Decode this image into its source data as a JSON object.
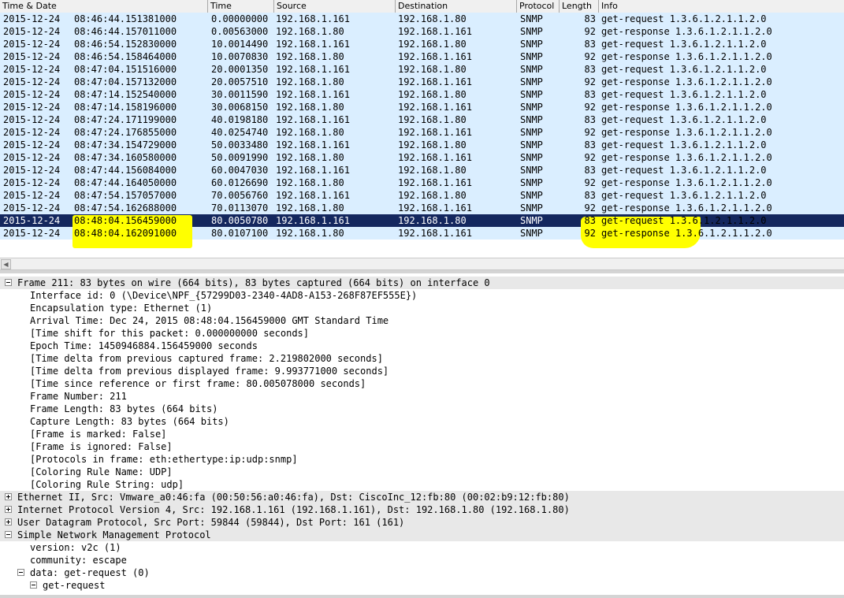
{
  "columns": {
    "time_date": "Time & Date",
    "time": "Time",
    "source": "Source",
    "destination": "Destination",
    "protocol": "Protocol",
    "length": "Length",
    "info": "Info"
  },
  "packets": [
    {
      "date": "2015-12-24",
      "clock": "08:46:44.151381000",
      "time": "0.00000000",
      "src": "192.168.1.161",
      "dst": "192.168.1.80",
      "proto": "SNMP",
      "len": "83",
      "info": "get-request 1.3.6.1.2.1.1.2.0"
    },
    {
      "date": "2015-12-24",
      "clock": "08:46:44.157011000",
      "time": "0.00563000",
      "src": "192.168.1.80",
      "dst": "192.168.1.161",
      "proto": "SNMP",
      "len": "92",
      "info": "get-response 1.3.6.1.2.1.1.2.0"
    },
    {
      "date": "2015-12-24",
      "clock": "08:46:54.152830000",
      "time": "10.0014490",
      "src": "192.168.1.161",
      "dst": "192.168.1.80",
      "proto": "SNMP",
      "len": "83",
      "info": "get-request 1.3.6.1.2.1.1.2.0"
    },
    {
      "date": "2015-12-24",
      "clock": "08:46:54.158464000",
      "time": "10.0070830",
      "src": "192.168.1.80",
      "dst": "192.168.1.161",
      "proto": "SNMP",
      "len": "92",
      "info": "get-response 1.3.6.1.2.1.1.2.0"
    },
    {
      "date": "2015-12-24",
      "clock": "08:47:04.151516000",
      "time": "20.0001350",
      "src": "192.168.1.161",
      "dst": "192.168.1.80",
      "proto": "SNMP",
      "len": "83",
      "info": "get-request 1.3.6.1.2.1.1.2.0"
    },
    {
      "date": "2015-12-24",
      "clock": "08:47:04.157132000",
      "time": "20.0057510",
      "src": "192.168.1.80",
      "dst": "192.168.1.161",
      "proto": "SNMP",
      "len": "92",
      "info": "get-response 1.3.6.1.2.1.1.2.0"
    },
    {
      "date": "2015-12-24",
      "clock": "08:47:14.152540000",
      "time": "30.0011590",
      "src": "192.168.1.161",
      "dst": "192.168.1.80",
      "proto": "SNMP",
      "len": "83",
      "info": "get-request 1.3.6.1.2.1.1.2.0"
    },
    {
      "date": "2015-12-24",
      "clock": "08:47:14.158196000",
      "time": "30.0068150",
      "src": "192.168.1.80",
      "dst": "192.168.1.161",
      "proto": "SNMP",
      "len": "92",
      "info": "get-response 1.3.6.1.2.1.1.2.0"
    },
    {
      "date": "2015-12-24",
      "clock": "08:47:24.171199000",
      "time": "40.0198180",
      "src": "192.168.1.161",
      "dst": "192.168.1.80",
      "proto": "SNMP",
      "len": "83",
      "info": "get-request 1.3.6.1.2.1.1.2.0"
    },
    {
      "date": "2015-12-24",
      "clock": "08:47:24.176855000",
      "time": "40.0254740",
      "src": "192.168.1.80",
      "dst": "192.168.1.161",
      "proto": "SNMP",
      "len": "92",
      "info": "get-response 1.3.6.1.2.1.1.2.0"
    },
    {
      "date": "2015-12-24",
      "clock": "08:47:34.154729000",
      "time": "50.0033480",
      "src": "192.168.1.161",
      "dst": "192.168.1.80",
      "proto": "SNMP",
      "len": "83",
      "info": "get-request 1.3.6.1.2.1.1.2.0"
    },
    {
      "date": "2015-12-24",
      "clock": "08:47:34.160580000",
      "time": "50.0091990",
      "src": "192.168.1.80",
      "dst": "192.168.1.161",
      "proto": "SNMP",
      "len": "92",
      "info": "get-response 1.3.6.1.2.1.1.2.0"
    },
    {
      "date": "2015-12-24",
      "clock": "08:47:44.156084000",
      "time": "60.0047030",
      "src": "192.168.1.161",
      "dst": "192.168.1.80",
      "proto": "SNMP",
      "len": "83",
      "info": "get-request 1.3.6.1.2.1.1.2.0"
    },
    {
      "date": "2015-12-24",
      "clock": "08:47:44.164050000",
      "time": "60.0126690",
      "src": "192.168.1.80",
      "dst": "192.168.1.161",
      "proto": "SNMP",
      "len": "92",
      "info": "get-response 1.3.6.1.2.1.1.2.0"
    },
    {
      "date": "2015-12-24",
      "clock": "08:47:54.157057000",
      "time": "70.0056760",
      "src": "192.168.1.161",
      "dst": "192.168.1.80",
      "proto": "SNMP",
      "len": "83",
      "info": "get-request 1.3.6.1.2.1.1.2.0"
    },
    {
      "date": "2015-12-24",
      "clock": "08:47:54.162688000",
      "time": "70.0113070",
      "src": "192.168.1.80",
      "dst": "192.168.1.161",
      "proto": "SNMP",
      "len": "92",
      "info": "get-response 1.3.6.1.2.1.1.2.0"
    },
    {
      "date": "2015-12-24",
      "clock": "08:48:04.156459000",
      "time": "80.0050780",
      "src": "192.168.1.161",
      "dst": "192.168.1.80",
      "proto": "SNMP",
      "len": "83",
      "info": "get-request 1.3.6.1.2.1.1.2.0"
    },
    {
      "date": "2015-12-24",
      "clock": "08:48:04.162091000",
      "time": "80.0107100",
      "src": "192.168.1.80",
      "dst": "192.168.1.161",
      "proto": "SNMP",
      "len": "92",
      "info": "get-response 1.3.6.1.2.1.1.2.0"
    }
  ],
  "details": [
    {
      "text": "Frame 211: 83 bytes on wire (664 bits), 83 bytes captured (664 bits) on interface 0",
      "toggle": "minus"
    },
    {
      "text": "Interface id: 0 (\\Device\\NPF_{57299D03-2340-4AD8-A153-268F87EF555E})",
      "toggle": ""
    },
    {
      "text": "Encapsulation type: Ethernet (1)",
      "toggle": ""
    },
    {
      "text": "Arrival Time: Dec 24, 2015 08:48:04.156459000 GMT Standard Time",
      "toggle": ""
    },
    {
      "text": "[Time shift for this packet: 0.000000000 seconds]",
      "toggle": ""
    },
    {
      "text": "Epoch Time: 1450946884.156459000 seconds",
      "toggle": ""
    },
    {
      "text": "[Time delta from previous captured frame: 2.219802000 seconds]",
      "toggle": ""
    },
    {
      "text": "[Time delta from previous displayed frame: 9.993771000 seconds]",
      "toggle": ""
    },
    {
      "text": "[Time since reference or first frame: 80.005078000 seconds]",
      "toggle": ""
    },
    {
      "text": "Frame Number: 211",
      "toggle": ""
    },
    {
      "text": "Frame Length: 83 bytes (664 bits)",
      "toggle": ""
    },
    {
      "text": "Capture Length: 83 bytes (664 bits)",
      "toggle": ""
    },
    {
      "text": "[Frame is marked: False]",
      "toggle": ""
    },
    {
      "text": "[Frame is ignored: False]",
      "toggle": ""
    },
    {
      "text": "[Protocols in frame: eth:ethertype:ip:udp:snmp]",
      "toggle": ""
    },
    {
      "text": "[Coloring Rule Name: UDP]",
      "toggle": ""
    },
    {
      "text": "[Coloring Rule String: udp]",
      "toggle": ""
    },
    {
      "text": "Ethernet II, Src: Vmware_a0:46:fa (00:50:56:a0:46:fa), Dst: CiscoInc_12:fb:80 (00:02:b9:12:fb:80)",
      "toggle": "plus"
    },
    {
      "text": "Internet Protocol Version 4, Src: 192.168.1.161 (192.168.1.161), Dst: 192.168.1.80 (192.168.1.80)",
      "toggle": "plus"
    },
    {
      "text": "User Datagram Protocol, Src Port: 59844 (59844), Dst Port: 161 (161)",
      "toggle": "plus"
    },
    {
      "text": "Simple Network Management Protocol",
      "toggle": "minus"
    },
    {
      "text": "version: v2c (1)",
      "toggle": ""
    },
    {
      "text": "community: escape",
      "toggle": ""
    },
    {
      "text": "data: get-request (0)",
      "toggle": "minus"
    },
    {
      "text": "get-request",
      "toggle": "minus"
    }
  ],
  "highlight_color": "#ffff00",
  "selected_row_color": "#14275e",
  "udp_row_color": "#daeeff"
}
